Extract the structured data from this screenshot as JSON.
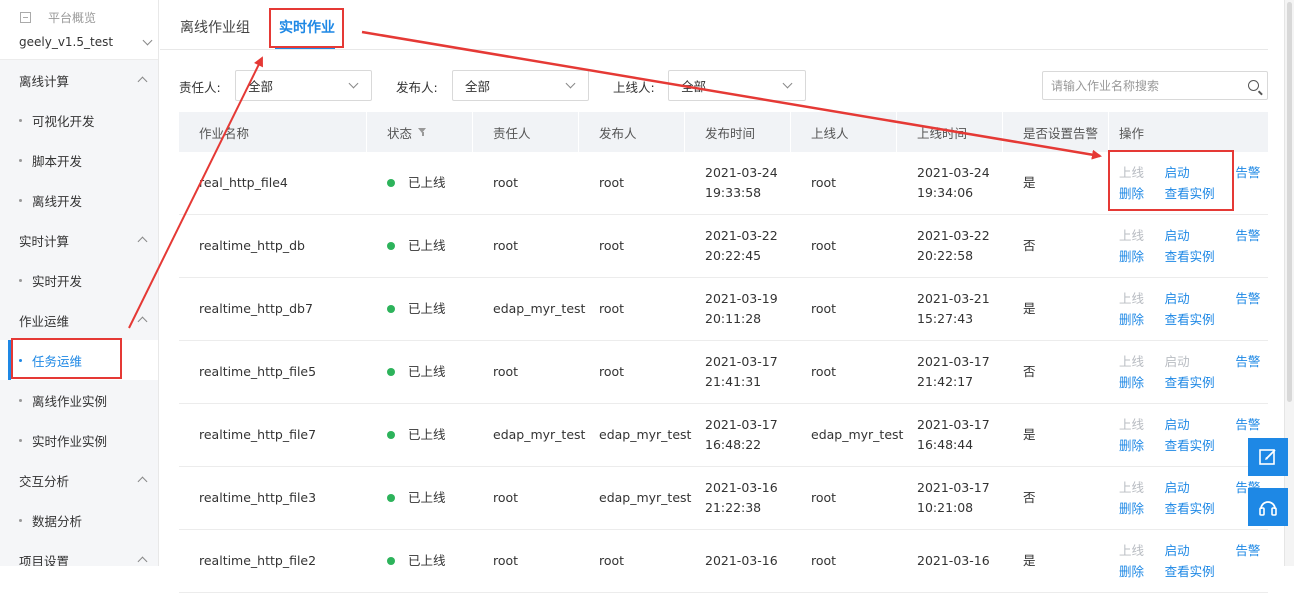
{
  "sidebar": {
    "overview_label": "平台概览",
    "project": "geely_v1.5_test",
    "groups": [
      {
        "label": "离线计算",
        "items": [
          "可视化开发",
          "脚本开发",
          "离线开发"
        ]
      },
      {
        "label": "实时计算",
        "items": [
          "实时开发"
        ]
      },
      {
        "label": "作业运维",
        "items": [
          "任务运维",
          "离线作业实例",
          "实时作业实例"
        ]
      },
      {
        "label": "交互分析",
        "items": [
          "数据分析"
        ]
      },
      {
        "label": "项目设置",
        "items": []
      }
    ],
    "active_item": "任务运维"
  },
  "tabs": [
    "离线作业组",
    "实时作业"
  ],
  "active_tab": "实时作业",
  "filters": {
    "owner_label": "责任人:",
    "owner_value": "全部",
    "publisher_label": "发布人:",
    "publisher_value": "全部",
    "onliner_label": "上线人:",
    "onliner_value": "全部",
    "search_placeholder": "请输入作业名称搜索"
  },
  "table": {
    "columns": [
      "作业名称",
      "状态",
      "责任人",
      "发布人",
      "发布时间",
      "上线人",
      "上线时间",
      "是否设置告警",
      "操作"
    ],
    "ops": {
      "online": "上线",
      "start": "启动",
      "alarm": "告警",
      "delete": "删除",
      "view": "查看实例"
    },
    "rows": [
      {
        "name": "real_http_file4",
        "status": "已上线",
        "owner": "root",
        "publisher": "root",
        "pub_date": "2021-03-24",
        "pub_time": "19:33:58",
        "onliner": "root",
        "on_date": "2021-03-24",
        "on_time": "19:34:06",
        "alarm": "是",
        "start_disabled": false
      },
      {
        "name": "realtime_http_db",
        "status": "已上线",
        "owner": "root",
        "publisher": "root",
        "pub_date": "2021-03-22",
        "pub_time": "20:22:45",
        "onliner": "root",
        "on_date": "2021-03-22",
        "on_time": "20:22:58",
        "alarm": "否",
        "start_disabled": false
      },
      {
        "name": "realtime_http_db7",
        "status": "已上线",
        "owner": "edap_myr_test",
        "publisher": "root",
        "pub_date": "2021-03-19",
        "pub_time": "20:11:28",
        "onliner": "root",
        "on_date": "2021-03-21",
        "on_time": "15:27:43",
        "alarm": "是",
        "start_disabled": false
      },
      {
        "name": "realtime_http_file5",
        "status": "已上线",
        "owner": "root",
        "publisher": "root",
        "pub_date": "2021-03-17",
        "pub_time": "21:41:31",
        "onliner": "root",
        "on_date": "2021-03-17",
        "on_time": "21:42:17",
        "alarm": "否",
        "start_disabled": true
      },
      {
        "name": "realtime_http_file7",
        "status": "已上线",
        "owner": "edap_myr_test",
        "publisher": "edap_myr_test",
        "pub_date": "2021-03-17",
        "pub_time": "16:48:22",
        "onliner": "edap_myr_test",
        "on_date": "2021-03-17",
        "on_time": "16:48:44",
        "alarm": "是",
        "start_disabled": false
      },
      {
        "name": "realtime_http_file3",
        "status": "已上线",
        "owner": "root",
        "publisher": "edap_myr_test",
        "pub_date": "2021-03-16",
        "pub_time": "21:22:38",
        "onliner": "root",
        "on_date": "2021-03-17",
        "on_time": "10:21:08",
        "alarm": "否",
        "start_disabled": false
      },
      {
        "name": "realtime_http_file2",
        "status": "已上线",
        "owner": "root",
        "publisher": "root",
        "pub_date": "2021-03-16",
        "pub_time": "",
        "onliner": "root",
        "on_date": "2021-03-16",
        "on_time": "",
        "alarm": "是",
        "start_disabled": false
      }
    ]
  },
  "icons": {
    "edit": "edit-icon",
    "headset": "headset-icon",
    "search": "search-icon",
    "filter": "filter-icon"
  },
  "colors": {
    "accent": "#1e88e5",
    "status_online": "#2db35b",
    "annotation": "#e53935",
    "disabled": "#b8bcc2"
  }
}
